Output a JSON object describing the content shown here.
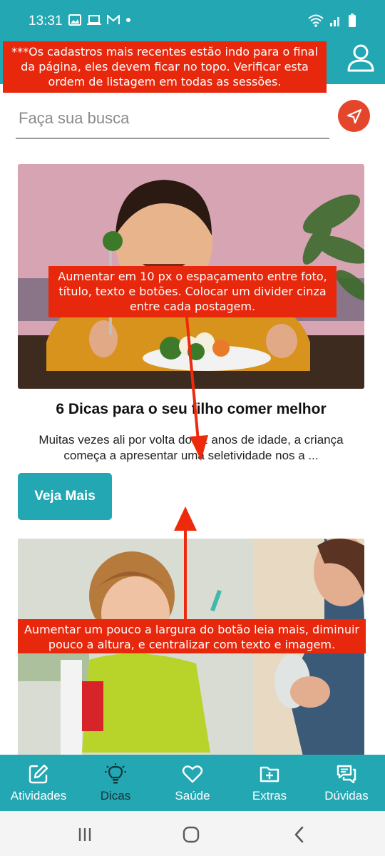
{
  "status_bar": {
    "time": "13:31"
  },
  "header": {
    "annotation": "***Os cadastros mais recentes estão indo para o final da página, eles devem ficar no topo. Verificar esta ordem de listagem em todas as sessões."
  },
  "search": {
    "placeholder": "Faça sua busca",
    "value": ""
  },
  "posts": [
    {
      "title": "6 Dicas para o seu filho comer melhor",
      "excerpt": "Muitas vezes ali por volta dos 2 anos de idade, a criança começa a apresentar uma seletividade nos a ...",
      "button_label": "Veja Mais"
    }
  ],
  "annotations": {
    "spacing": "Aumentar em 10 px o espaçamento entre foto, título, texto e botões. Colocar um divider cinza entre cada postagem.",
    "button": "Aumentar um pouco a largura do botão leia mais, diminuir pouco a altura, e centralizar com texto e imagem."
  },
  "bottom_nav": [
    {
      "label": "Atividades",
      "icon": "edit-icon"
    },
    {
      "label": "Dicas",
      "icon": "lightbulb-icon"
    },
    {
      "label": "Saúde",
      "icon": "heart-icon"
    },
    {
      "label": "Extras",
      "icon": "folder-plus-icon"
    },
    {
      "label": "Dúvidas",
      "icon": "chat-icon"
    }
  ],
  "colors": {
    "primary": "#22a7b3",
    "annotation": "#e8280c",
    "fab": "#e4462c",
    "nav_active": "#16343c"
  }
}
